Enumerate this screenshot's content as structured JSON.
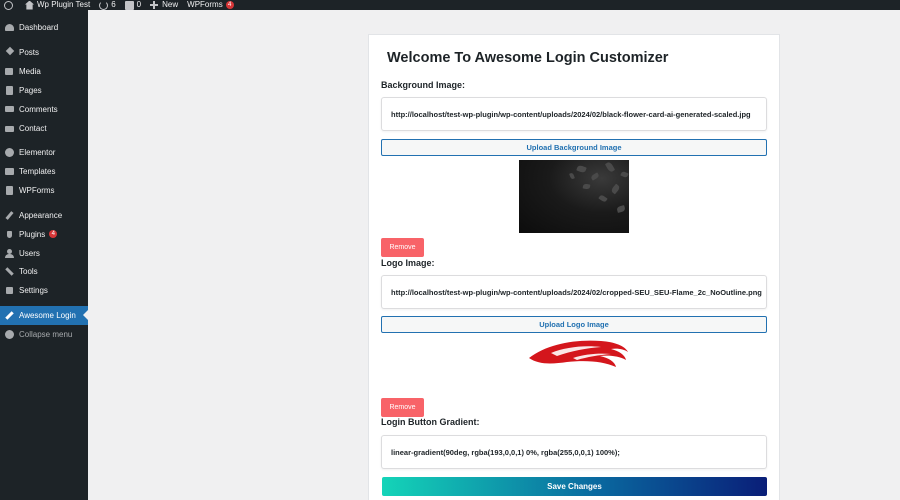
{
  "adminbar": {
    "site_name": "Wp Plugin Test",
    "updates_count": "6",
    "comments_count": "0",
    "new_label": "New",
    "wpforms_label": "WPForms",
    "wpforms_badge": "4"
  },
  "sidebar": {
    "items": [
      {
        "label": "Dashboard",
        "icon": "dashboard-icon"
      },
      {
        "label": "Posts",
        "icon": "pin-icon"
      },
      {
        "label": "Media",
        "icon": "media-icon"
      },
      {
        "label": "Pages",
        "icon": "pages-icon"
      },
      {
        "label": "Comments",
        "icon": "comment-icon"
      },
      {
        "label": "Contact",
        "icon": "mail-icon"
      },
      {
        "label": "Elementor",
        "icon": "elementor-icon"
      },
      {
        "label": "Templates",
        "icon": "folder-icon"
      },
      {
        "label": "WPForms",
        "icon": "form-icon"
      },
      {
        "label": "Appearance",
        "icon": "brush-icon"
      },
      {
        "label": "Plugins",
        "icon": "plug-icon",
        "badge": "4"
      },
      {
        "label": "Users",
        "icon": "users-icon"
      },
      {
        "label": "Tools",
        "icon": "wrench-icon"
      },
      {
        "label": "Settings",
        "icon": "settings-icon"
      },
      {
        "label": "Awesome Login",
        "icon": "pen-icon",
        "active": true
      },
      {
        "label": "Collapse menu",
        "icon": "collapse-icon"
      }
    ]
  },
  "page": {
    "title": "Welcome To Awesome Login Customizer",
    "background": {
      "label": "Background Image:",
      "value": "http://localhost/test-wp-plugin/wp-content/uploads/2024/02/black-flower-card-ai-generated-scaled.jpg",
      "upload_label": "Upload Background Image",
      "remove_label": "Remove"
    },
    "logo": {
      "label": "Logo Image:",
      "value": "http://localhost/test-wp-plugin/wp-content/uploads/2024/02/cropped-SEU_SEU-Flame_2c_NoOutline.png",
      "upload_label": "Upload Logo Image",
      "remove_label": "Remove"
    },
    "gradient": {
      "label": "Login Button Gradient:",
      "value": "linear-gradient(90deg, rgba(193,0,0,1) 0%, rgba(255,0,0,1) 100%);"
    },
    "save_label": "Save Changes"
  },
  "colors": {
    "admin_dark": "#1d2327",
    "active_blue": "#2271b1",
    "remove_red": "#f86368",
    "badge_red": "#d63638",
    "logo_red": "#d4161c"
  }
}
